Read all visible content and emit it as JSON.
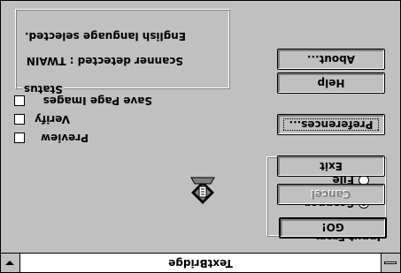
{
  "window": {
    "title": "TextBridge"
  },
  "input_group": {
    "label": "Input From",
    "options": [
      {
        "label": "Scanner",
        "selected": true
      },
      {
        "label": "File",
        "selected": false
      }
    ]
  },
  "options": {
    "preview": "Preview",
    "verify": "Verify",
    "save_page_images": "Save Page Images"
  },
  "status": {
    "label": "Status",
    "line1": "Scanner detected : TWAIN",
    "line2": "English language selected."
  },
  "buttons": {
    "go": "GO!",
    "cancel": "Cancel",
    "exit": "Exit",
    "preferences": "Preferences...",
    "help": "Help",
    "about": "About..."
  },
  "colors": {
    "face": "#c0c0c0",
    "shadow": "#808080",
    "highlight": "#ffffff",
    "text": "#000000"
  }
}
